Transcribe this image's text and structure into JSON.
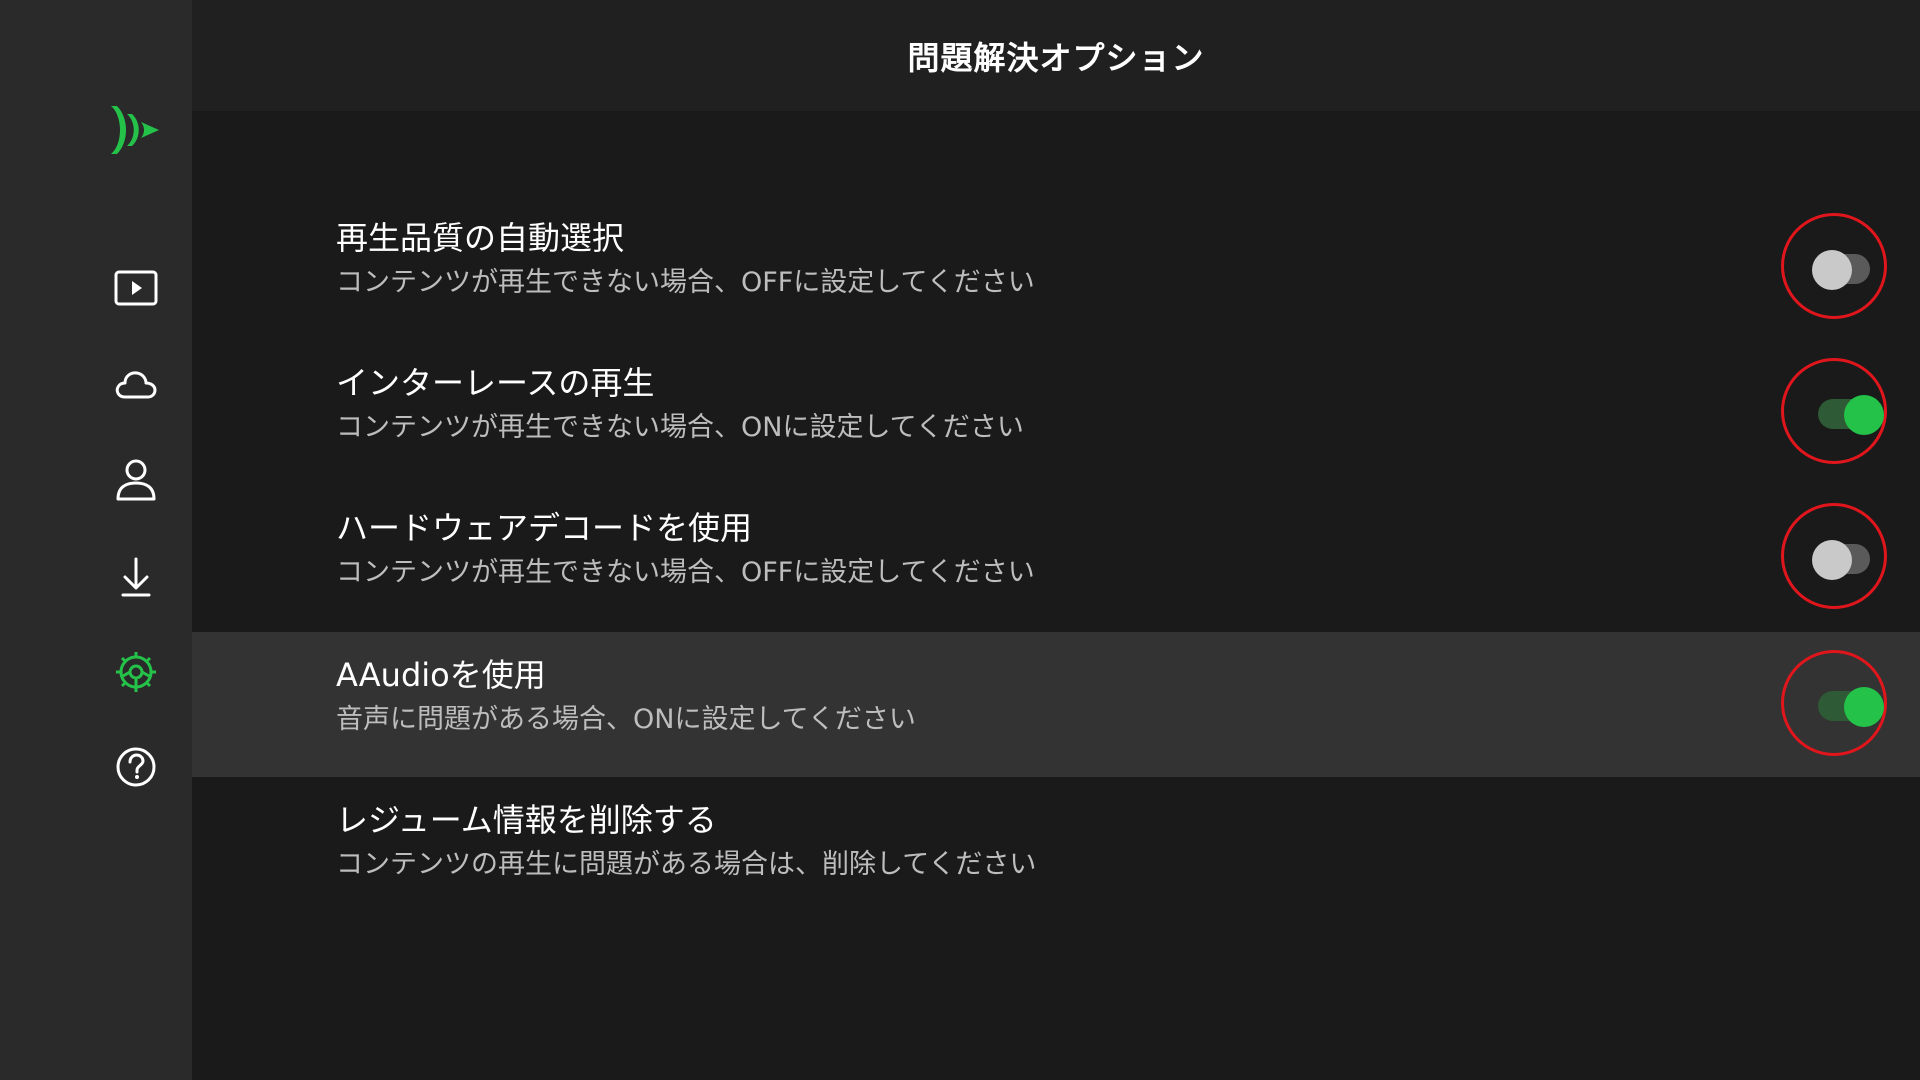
{
  "header": {
    "title": "問題解決オプション"
  },
  "sidebar": {
    "items": [
      {
        "icon": "play-icon"
      },
      {
        "icon": "cloud-icon"
      },
      {
        "icon": "person-icon"
      },
      {
        "icon": "download-icon"
      },
      {
        "icon": "settings-icon",
        "active": true
      },
      {
        "icon": "help-icon"
      }
    ],
    "accent_color": "#25c24a"
  },
  "options": [
    {
      "title": "再生品質の自動選択",
      "description": "コンテンツが再生できない場合、OFFに設定してください",
      "toggle": "off"
    },
    {
      "title": "インターレースの再生",
      "description": "コンテンツが再生できない場合、ONに設定してください",
      "toggle": "on"
    },
    {
      "title": "ハードウェアデコードを使用",
      "description": "コンテンツが再生できない場合、OFFに設定してください",
      "toggle": "off"
    },
    {
      "title": "AAudioを使用",
      "description": "音声に問題がある場合、ONに設定してください",
      "toggle": "on",
      "focused": true
    },
    {
      "title": "レジューム情報を削除する",
      "description": "コンテンツの再生に問題がある場合は、削除してください"
    }
  ],
  "colors": {
    "background": "#1a1a1a",
    "sidebar": "#2a2a2a",
    "focused_row": "#333333",
    "toggle_on": "#25c24a",
    "highlight_circle": "#e0161c"
  }
}
